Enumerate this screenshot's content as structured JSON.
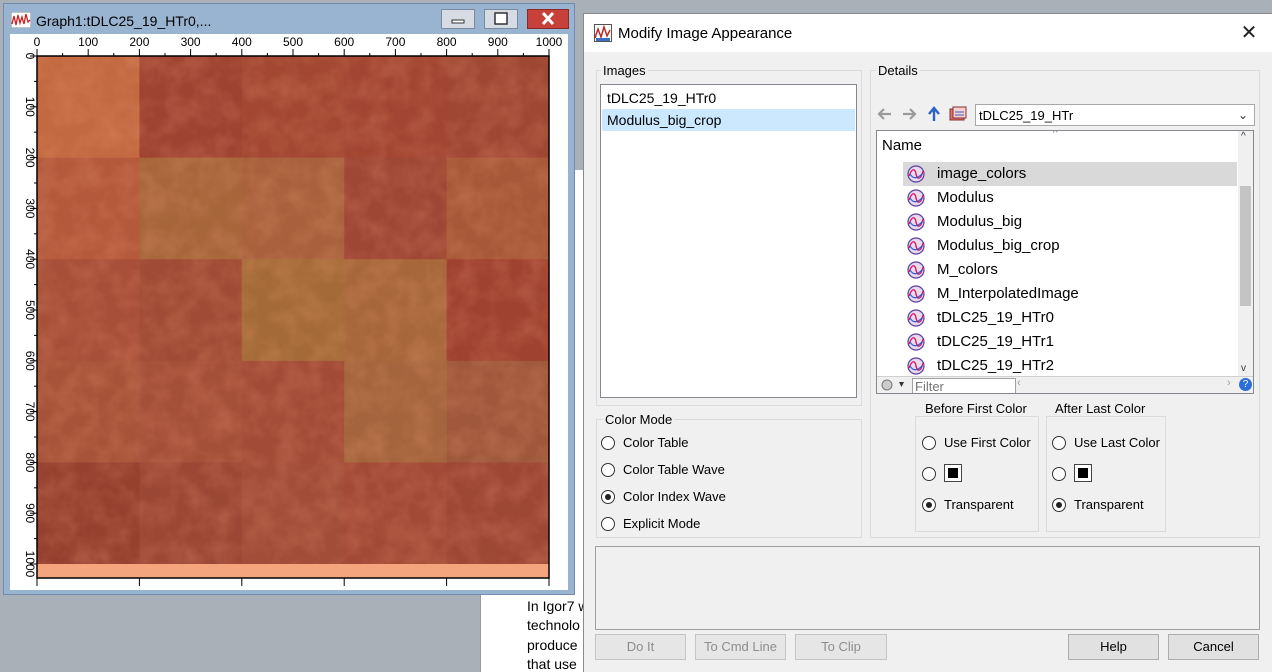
{
  "background_window": {
    "fragments": [
      "hi",
      "T",
      "r",
      "ir",
      "i",
      "a",
      "ar",
      "x",
      "C",
      "le",
      "o",
      "n",
      "w",
      "p",
      "b",
      "e",
      "n",
      "In Igor7 w",
      "technolo",
      "produce",
      "that use"
    ]
  },
  "graph_window": {
    "title": "Graph1:tDLC25_19_HTr0,...",
    "top_axis_ticks": [
      "0",
      "100",
      "200",
      "300",
      "400",
      "500",
      "600",
      "700",
      "800",
      "900",
      "1000"
    ],
    "left_axis_ticks": [
      "0",
      "100",
      "200",
      "300",
      "400",
      "500",
      "600",
      "700",
      "800",
      "900",
      "1000"
    ]
  },
  "dialog": {
    "title": "Modify Image Appearance",
    "images_group_label": "Images",
    "images": [
      "tDLC25_19_HTr0",
      "Modulus_big_crop"
    ],
    "selected_image": "Modulus_big_crop",
    "details_group_label": "Details",
    "folder_combo_value": "tDLC25_19_HTr",
    "tree_header": "Name",
    "waves": [
      "image_colors",
      "Modulus",
      "Modulus_big",
      "Modulus_big_crop",
      "M_colors",
      "M_InterpolatedImage",
      "tDLC25_19_HTr0",
      "tDLC25_19_HTr1",
      "tDLC25_19_HTr2"
    ],
    "selected_wave": "image_colors",
    "filter_placeholder": "Filter",
    "color_mode": {
      "label": "Color Mode",
      "options": [
        "Color Table",
        "Color Table Wave",
        "Color Index Wave",
        "Explicit Mode"
      ],
      "selected": "Color Index Wave"
    },
    "before_first_color": {
      "label": "Before First Color",
      "options": [
        "Use First Color",
        "",
        "Transparent"
      ],
      "selected": "Transparent"
    },
    "after_last_color": {
      "label": "After Last Color",
      "options": [
        "Use Last Color",
        "",
        "Transparent"
      ],
      "selected": "Transparent"
    },
    "buttons": {
      "do_it": "Do It",
      "to_cmd_line": "To Cmd Line",
      "to_clip": "To Clip",
      "help": "Help",
      "cancel": "Cancel"
    }
  },
  "colors": {
    "graph_window_frame": "#99b4d1",
    "close_button": "#c7403a",
    "selection": "#cce8ff",
    "image_base": "#a04a33",
    "image_bottom_band": "#f4a57e"
  }
}
